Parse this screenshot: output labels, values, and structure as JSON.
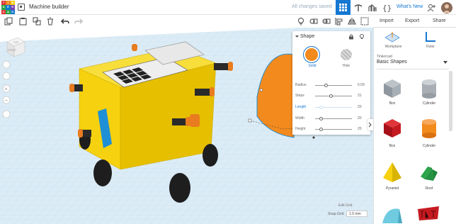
{
  "app": {
    "logo_letters": [
      "TIN",
      "KER",
      "CAD"
    ],
    "title": "Machine builder",
    "save_status": "All changes saved",
    "whats_new": "What's New"
  },
  "rightbar": {
    "import": "Import",
    "export": "Export",
    "share": "Share"
  },
  "shape_panel": {
    "header": "Shape",
    "solid_label": "Solid",
    "hole_label": "Hole",
    "rows": [
      {
        "label": "Radius",
        "value": "6.09"
      },
      {
        "label": "Steps",
        "value": "31"
      },
      {
        "label": "Length",
        "value": "20"
      },
      {
        "label": "Width",
        "value": "20"
      },
      {
        "label": "Height",
        "value": "20"
      }
    ]
  },
  "library": {
    "workplane_label": "Workplane",
    "ruler_label": "Ruler",
    "category_caption": "Tinkercad",
    "category": "Basic Shapes",
    "items": [
      {
        "label": "Box",
        "color": "#9aa4ad"
      },
      {
        "label": "Cylinder",
        "color": "#a8aeb4"
      },
      {
        "label": "Box",
        "color": "#d11a1f"
      },
      {
        "label": "Cylinder",
        "color": "#f28a1e"
      },
      {
        "label": "Pyramid",
        "color": "#f5d10f"
      },
      {
        "label": "Roof",
        "color": "#2ca54a"
      }
    ]
  },
  "workplane": {
    "edit_grid": "Edit Grid",
    "snap_grid_label": "Snap Grid",
    "snap_grid_value": "1.0 mm",
    "view_cube_top": "TOP",
    "view_cube_front": "FRONT"
  },
  "colors": {
    "accent": "#1477d1",
    "orange": "#f28a1e",
    "yellow": "#f5d10f",
    "grid_bg": "#e9f2f7",
    "grid_line": "#b9d7ea"
  }
}
